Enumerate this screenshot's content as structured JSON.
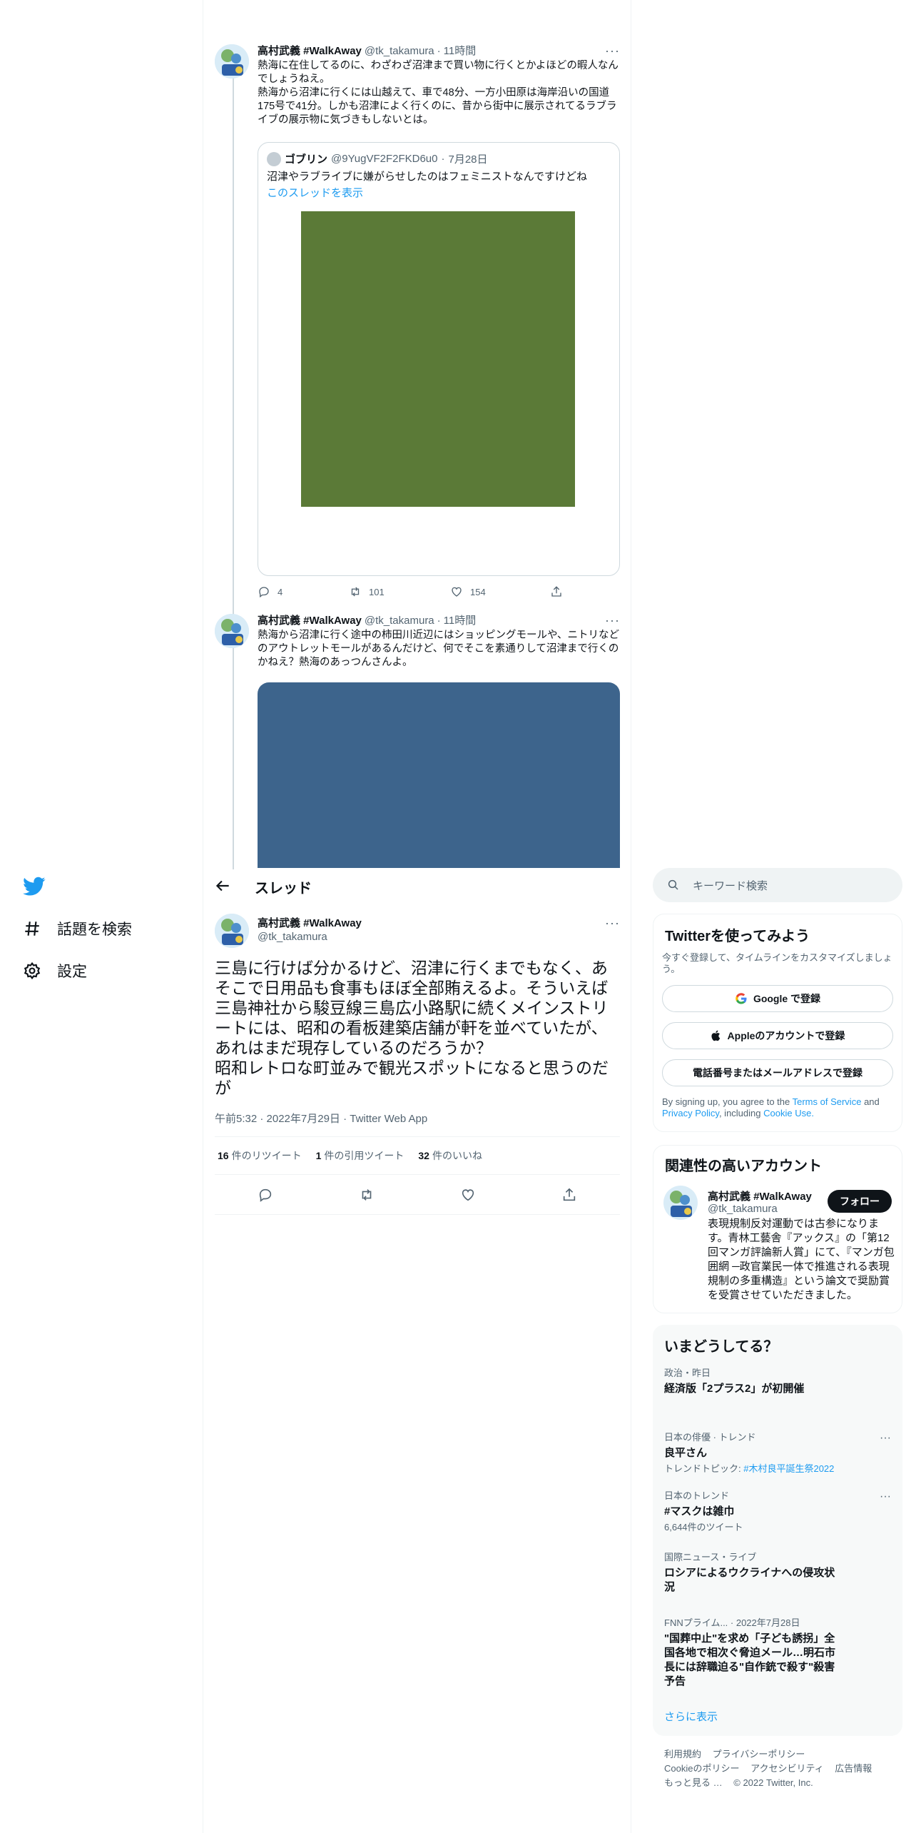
{
  "nav": {
    "explore_label": "話題を検索",
    "settings_label": "設定"
  },
  "thread": [
    {
      "name": "高村武義 #WalkAway",
      "handle": "@tk_takamura",
      "dot": "·",
      "time": "11時間",
      "more": "···",
      "text": "熱海に在住してるのに、わざわざ沼津まで買い物に行くとかよほどの暇人なんでしょうねえ。\n熱海から沼津に行くには山越えて、車で48分、一方小田原は海岸沿いの国道175号で41分。しかも沼津によく行くのに、昔から街中に展示されてるラブライブの展示物に気づきもしないとは。",
      "quote": {
        "name": "ゴブリン",
        "handle": "@9YugVF2F2FKD6u0",
        "dot": "·",
        "time": "7月28日",
        "text": "沼津やラブライブに嫌がらせしたのはフェミニストなんですけどね",
        "link": "このスレッドを表示"
      },
      "replies": "4",
      "retweets": "101",
      "likes": "154"
    },
    {
      "name": "高村武義 #WalkAway",
      "handle": "@tk_takamura",
      "dot": "·",
      "time": "11時間",
      "more": "···",
      "text": "熱海から沼津に行く途中の柿田川近辺にはショッピングモールや、ニトリなどのアウトレットモールがあるんだけど、何でそこを素通りして沼津まで行くのかねえ？熱海のあっつんさんよ。"
    }
  ],
  "header": {
    "title": "スレッド"
  },
  "main_tweet": {
    "name": "高村武義 #WalkAway",
    "handle": "@tk_takamura",
    "more": "···",
    "text": "三島に行けば分かるけど、沼津に行くまでもなく、あそこで日用品も食事もほぼ全部賄えるよ。そういえば三島神社から駿豆線三島広小路駅に続くメインストリートには、昭和の看板建築店舗が軒を並べていたが、あれはまだ現存しているのだろうか？\n昭和レトロな町並みで観光スポットになると思うのだが",
    "meta": "午前5:32 · 2022年7月29日 · Twitter Web App",
    "retweets_count": "16",
    "retweets_label": "件のリツイート",
    "quotes_count": "1",
    "quotes_label": "件の引用ツイート",
    "likes_count": "32",
    "likes_label": "件のいいね"
  },
  "search": {
    "placeholder": "キーワード検索"
  },
  "signup": {
    "title": "Twitterを使ってみよう",
    "subtitle": "今すぐ登録して、タイムラインをカスタマイズしましょう。",
    "google_label": "Google で登録",
    "apple_label": "Appleのアカウントで登録",
    "phone_label": "電話番号またはメールアドレスで登録",
    "terms_prefix": "By signing up, you agree to the",
    "terms_link": "Terms of Service",
    "terms_and": "and",
    "privacy_link": "Privacy Policy",
    "terms_including": ", including",
    "cookie_link": "Cookie Use."
  },
  "related": {
    "title": "関連性の高いアカウント",
    "name": "高村武義 #WalkAway",
    "handle": "@tk_takamura",
    "follow_label": "フォロー",
    "bio": "表現規制反対運動では古参になります。青林工藝舎『アックス』の「第12回マンガ評論新人賞」にて、『マンガ包囲網 ─政官業民一体で推進される表現規制の多重構造』という論文で奨励賞を受賞させていただきました。"
  },
  "trends": {
    "title": "いまどうしてる？",
    "items": [
      {
        "context": "政治・昨日",
        "title": "経済版「2プラス2」が初開催",
        "sub": "",
        "tag": ""
      },
      {
        "context": "日本の俳優 · トレンド",
        "title": "良平さん",
        "sub": "トレンドトピック: ",
        "tag": "#木村良平誕生祭2022"
      },
      {
        "context": "日本のトレンド",
        "title": "#マスクは雑巾",
        "sub": "6,644件のツイート",
        "tag": ""
      },
      {
        "context": "国際ニュース・ライブ",
        "title": "ロシアによるウクライナへの侵攻状況",
        "sub": "",
        "tag": ""
      },
      {
        "context": "FNNプライム... · 2022年7月28日",
        "title": "\"国葬中止\"を求め「子ども誘拐」全国各地で相次ぐ脅迫メール…明石市長には辞職迫る\"自作銃で殺す\"殺害予告",
        "sub": "",
        "tag": ""
      }
    ],
    "more": "···",
    "show_more": "さらに表示"
  },
  "footer": {
    "terms": "利用規約",
    "privacy": "プライバシーポリシー",
    "cookie": "Cookieのポリシー",
    "accessibility": "アクセシビリティ",
    "ads": "広告情報",
    "more": "もっと見る …",
    "copyright": "© 2022 Twitter, Inc."
  },
  "colors": {
    "accent": "#1d9bf0",
    "quote_image": "#5b7a37",
    "media_image": "#3d648c"
  }
}
